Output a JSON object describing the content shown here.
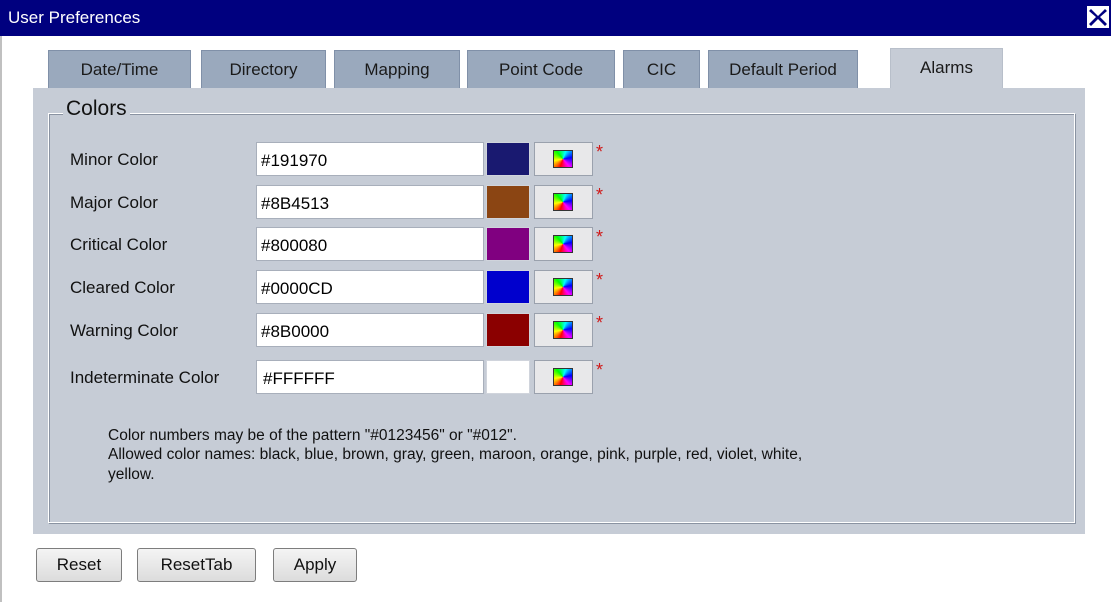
{
  "window": {
    "title": "User Preferences",
    "close_icon": "close-x-icon"
  },
  "tabs": [
    {
      "label": "Date/Time",
      "active": false
    },
    {
      "label": "Directory",
      "active": false
    },
    {
      "label": "Mapping",
      "active": false
    },
    {
      "label": "Point Code",
      "active": false
    },
    {
      "label": "CIC",
      "active": false
    },
    {
      "label": "Default Period",
      "active": false
    },
    {
      "label": "Alarms",
      "active": true
    }
  ],
  "colors_section": {
    "legend": "Colors",
    "rows": [
      {
        "label": "Minor Color",
        "value": "#191970",
        "swatch": "#191970",
        "required": "*"
      },
      {
        "label": "Major Color",
        "value": "#8B4513",
        "swatch": "#8B4513",
        "required": "*"
      },
      {
        "label": "Critical Color",
        "value": "#800080",
        "swatch": "#800080",
        "required": "*"
      },
      {
        "label": "Cleared Color",
        "value": "#0000CD",
        "swatch": "#0000CD",
        "required": "*"
      },
      {
        "label": "Warning Color",
        "value": "#8B0000",
        "swatch": "#8B0000",
        "required": "*"
      },
      {
        "label": "Indeterminate Color",
        "value": "#FFFFFF",
        "swatch": "#FFFFFF",
        "required": "*"
      }
    ],
    "help": [
      "Color numbers may be of the pattern \"#0123456\" or \"#012\".",
      "Allowed color names: black, blue, brown, gray, green, maroon, orange, pink, purple, red, violet, white,",
      "yellow."
    ]
  },
  "buttons": {
    "reset": "Reset",
    "reset_tab": "ResetTab",
    "apply": "Apply"
  },
  "theme": {
    "titlebar": "#00007F",
    "tab_inactive": "#9AA9BD",
    "panel": "#C6CCD6",
    "required_star": "#D01818"
  }
}
